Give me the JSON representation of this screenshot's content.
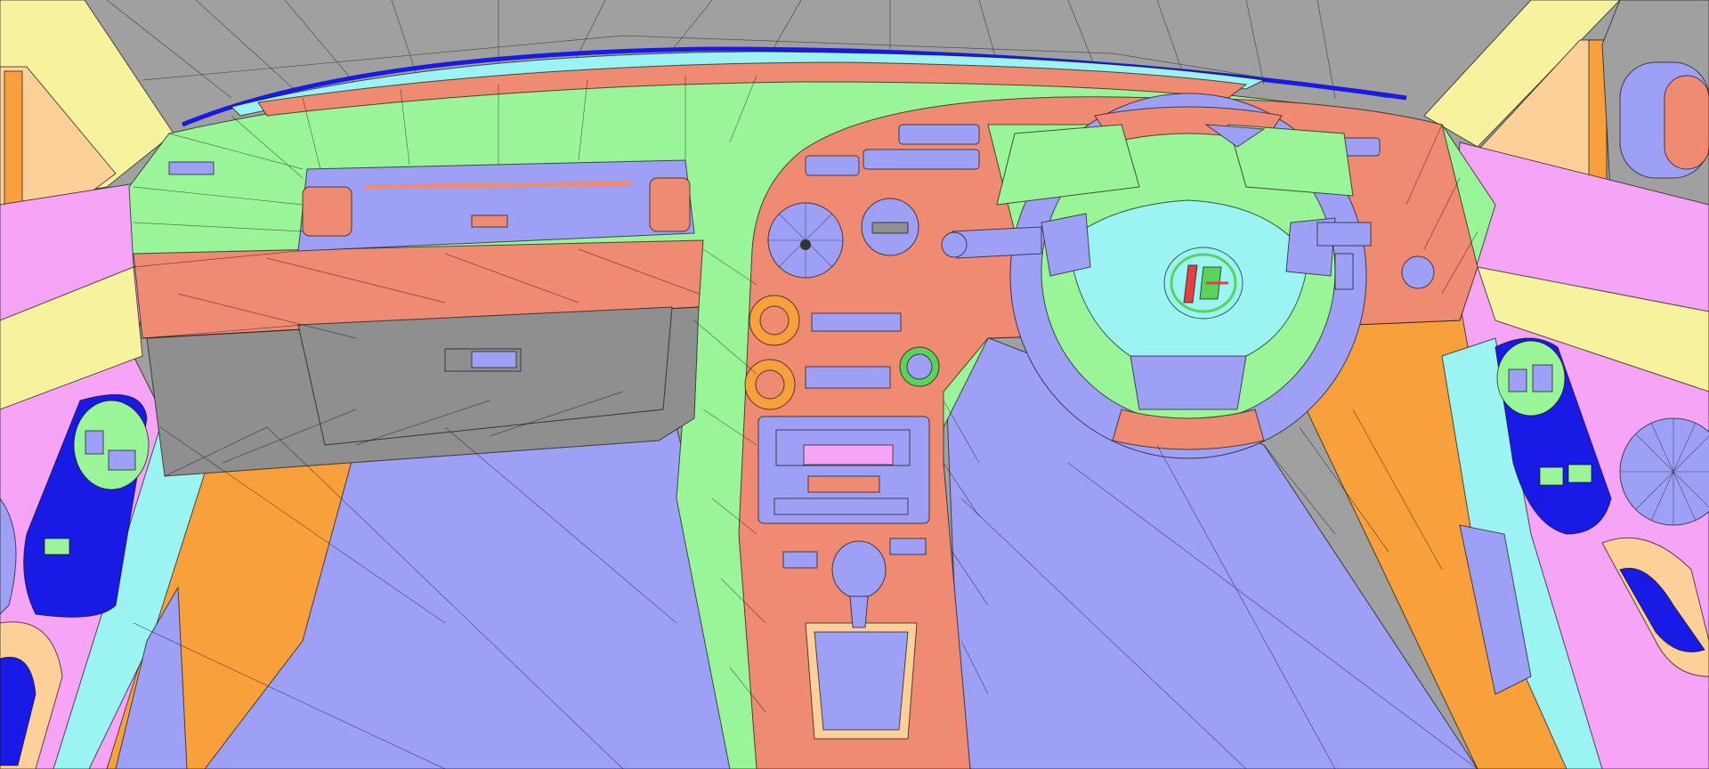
{
  "scene": {
    "colors": {
      "background": "#a0a0a0",
      "dash_top": "#9af598",
      "dash_lower": "#ef8a73",
      "glovebox": "#8f8f8f",
      "floor": "#9ea0f6",
      "orange": "#f8a13c",
      "pink": "#f6a4f6",
      "cyan": "#9cf4f2",
      "yellow": "#f6f29e",
      "peach": "#fdd09a",
      "blue_dark": "#1a1ae6",
      "wheel": "#9ea0f6",
      "hub": "#9cf4f2",
      "emblem_green": "#59d359",
      "emblem_red": "#e14141"
    },
    "icons": [
      "steering-wheel-icon",
      "gauge-icon",
      "gear-shifter-icon",
      "car-emblem-icon"
    ]
  }
}
